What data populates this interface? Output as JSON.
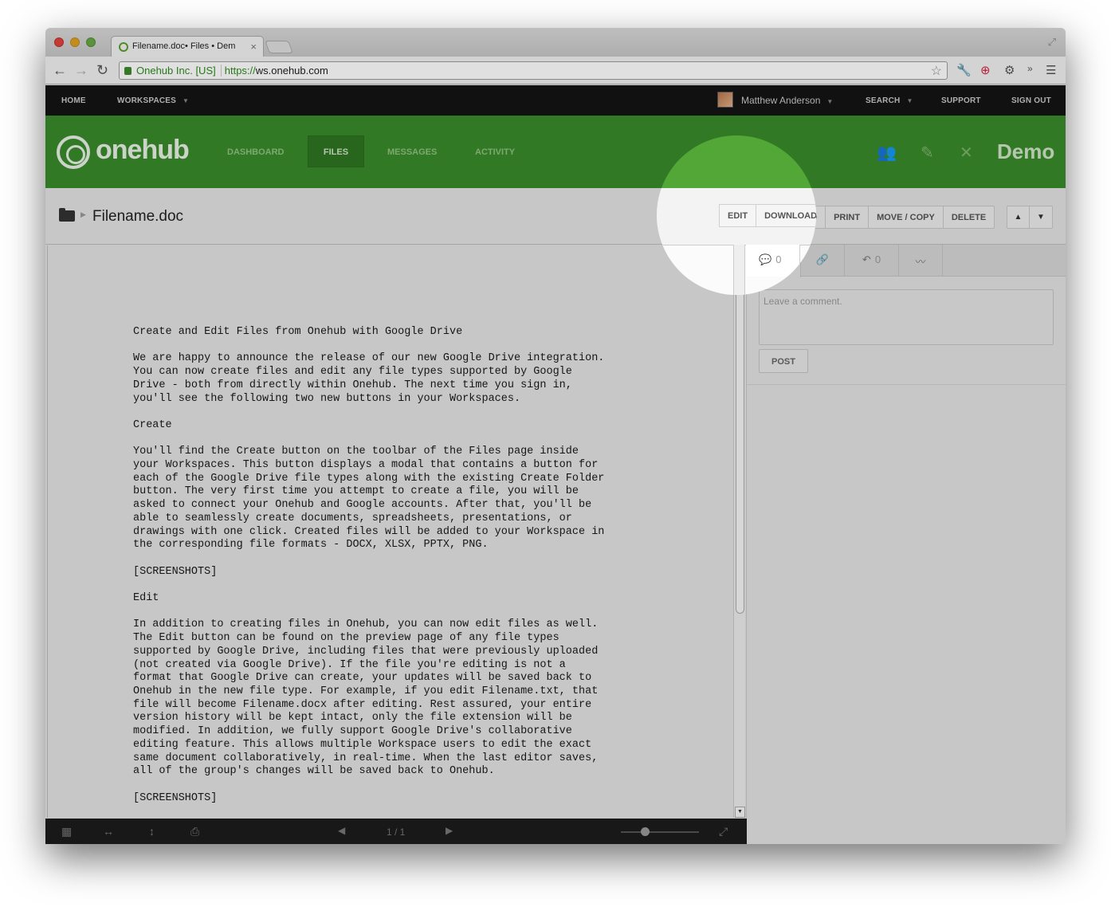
{
  "browser": {
    "tab_title": "Filename.doc• Files • Dem",
    "tab_close": "×",
    "ev_label": "Onehub Inc. [US]",
    "url_scheme": "https://",
    "url_host": "ws.onehub.com",
    "overflow": "»"
  },
  "topbar": {
    "home": "HOME",
    "workspaces": "WORKSPACES",
    "user": "Matthew Anderson",
    "search": "SEARCH",
    "support": "SUPPORT",
    "sign_out": "SIGN OUT"
  },
  "header": {
    "brand": "onehub",
    "tabs": [
      "DASHBOARD",
      "FILES",
      "MESSAGES",
      "ACTIVITY"
    ],
    "workspace_name": "Demo"
  },
  "file": {
    "name": "Filename.doc",
    "actions": [
      "EDIT",
      "DOWNLOAD",
      "PRINT",
      "MOVE / COPY",
      "DELETE"
    ]
  },
  "document": {
    "text": "Create and Edit Files from Onehub with Google Drive\n\nWe are happy to announce the release of our new Google Drive integration.\nYou can now create files and edit any file types supported by Google\nDrive - both from directly within Onehub. The next time you sign in,\nyou'll see the following two new buttons in your Workspaces.\n\nCreate\n\nYou'll find the Create button on the toolbar of the Files page inside\nyour Workspaces. This button displays a modal that contains a button for\neach of the Google Drive file types along with the existing Create Folder\nbutton. The very first time you attempt to create a file, you will be\nasked to connect your Onehub and Google accounts. After that, you'll be\nable to seamlessly create documents, spreadsheets, presentations, or\ndrawings with one click. Created files will be added to your Workspace in\nthe corresponding file formats - DOCX, XLSX, PPTX, PNG.\n\n[SCREENSHOTS]\n\nEdit\n\nIn addition to creating files in Onehub, you can now edit files as well.\nThe Edit button can be found on the preview page of any file types\nsupported by Google Drive, including files that were previously uploaded\n(not created via Google Drive). If the file you're editing is not a\nformat that Google Drive can create, your updates will be saved back to\nOnehub in the new file type. For example, if you edit Filename.txt, that\nfile will become Filename.docx after editing. Rest assured, your entire\nversion history will be kept intact, only the file extension will be\nmodified. In addition, we fully support Google Drive's collaborative\nediting feature. This allows multiple Workspace users to edit the exact\nsame document collaboratively, in real-time. When the last editor saves,\nall of the group's changes will be saved back to Onehub.\n\n[SCREENSHOTS]",
    "page_indicator": "1 / 1"
  },
  "sidebar": {
    "comment_count": "0",
    "version_count": "0",
    "comment_placeholder": "Leave a comment.",
    "post_label": "POST"
  },
  "colors": {
    "brand_green": "#3a8a2c",
    "topbar_black": "#141414"
  },
  "icons": [
    "comment-icon",
    "link-icon",
    "versions-icon",
    "activity-icon",
    "folder-icon",
    "gear-icon",
    "wrench-icon",
    "star-icon"
  ]
}
